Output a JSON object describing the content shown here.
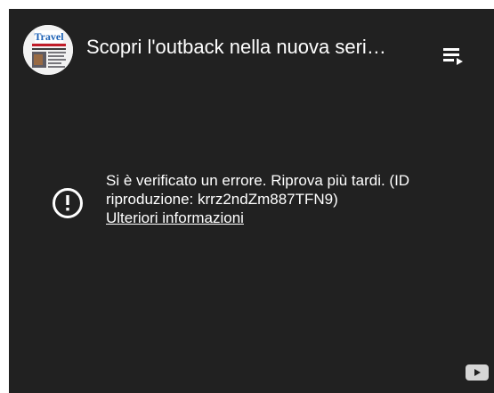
{
  "header": {
    "title": "Scopri l'outback nella nuova seri…",
    "avatar_icon": "travel-magazine-avatar",
    "avatar_text": "Travel",
    "playlist_icon": "playlist-icon"
  },
  "error": {
    "icon": "error-circle-icon",
    "message": "Si è verificato un errore. Riprova più tardi. (ID riproduzione: krrz2ndZm887TFN9)",
    "link_label": "Ulteriori informazioni"
  },
  "footer": {
    "logo_icon": "youtube-logo-icon"
  },
  "colors": {
    "background": "#212121",
    "text": "#ffffff"
  }
}
